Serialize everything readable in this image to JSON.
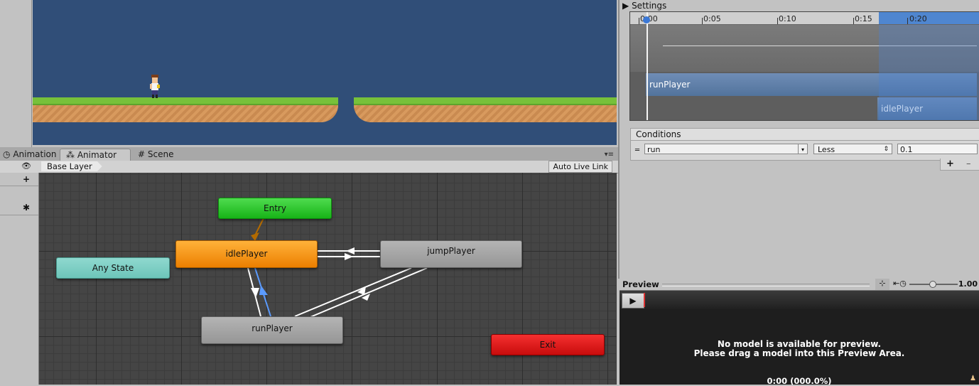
{
  "scene": {
    "left_platform": "grass-platform",
    "right_platform": "grass-platform"
  },
  "tabs": [
    {
      "label": "Animation",
      "icon": "animation-icon"
    },
    {
      "label": "Animator",
      "icon": "animator-icon",
      "active": true
    },
    {
      "label": "Scene",
      "icon": "scene-grid-icon"
    }
  ],
  "animator": {
    "breadcrumb": "Base Layer",
    "live_link": "Auto Live Link",
    "states": {
      "entry": "Entry",
      "idle": "idlePlayer",
      "any": "Any State",
      "jump": "jumpPlayer",
      "run": "runPlayer",
      "exit": "Exit"
    },
    "colors": {
      "entry": "#2cc72c",
      "default_state": "#f29a1a",
      "any_state": "#7ccdc3",
      "exit": "#e01b1b",
      "selected_transition": "#5b9bff"
    }
  },
  "inspector": {
    "settings_label": "Settings",
    "ruler_ticks": [
      "0:00",
      "0:05",
      "0:10",
      "0:15",
      "0:20"
    ],
    "clip_from": "runPlayer",
    "clip_to": "idlePlayer",
    "conditions_title": "Conditions",
    "condition": {
      "parameter": "run",
      "operator": "Less",
      "value": "0.1"
    },
    "add_label": "+",
    "remove_label": "–"
  },
  "preview": {
    "title": "Preview",
    "speed": "1.00",
    "message_line1": "No model is available for preview.",
    "message_line2": "Please drag a model into this Preview Area.",
    "time": "0:00 (000.0%)"
  }
}
